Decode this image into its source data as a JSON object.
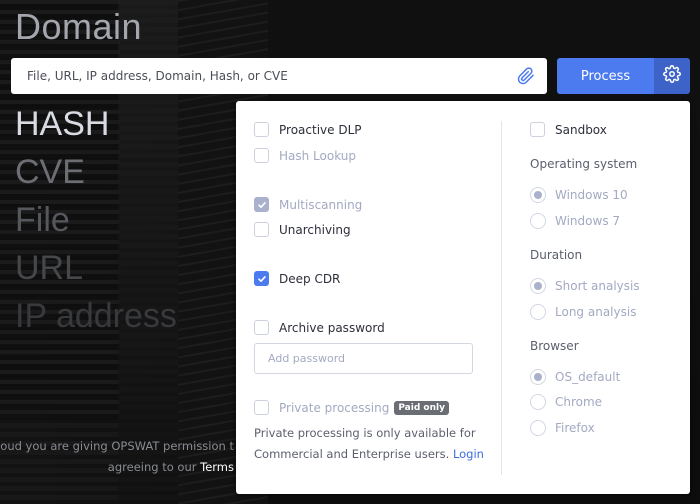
{
  "page": {
    "headline": "Domain",
    "search": {
      "placeholder": "File, URL, IP address, Domain, Hash, or CVE",
      "value": ""
    },
    "process_label": "Process",
    "icons": {
      "attach": "paperclip-icon",
      "settings": "gear-icon"
    },
    "colors": {
      "accent": "#4b7bef",
      "accent_dark": "#3d63c8",
      "link": "#3d6fe0"
    },
    "rotating_types": [
      "HASH",
      "CVE",
      "File",
      "URL",
      "IP address"
    ],
    "footer": {
      "line1": "der Cloud you are giving OPSWAT permission t",
      "line2_prefix": "agreeing to our ",
      "terms_link": "Terms"
    }
  },
  "settings_panel": {
    "left": {
      "proactive_dlp": {
        "label": "Proactive DLP",
        "checked": false,
        "disabled": false
      },
      "hash_lookup": {
        "label": "Hash Lookup",
        "checked": false,
        "disabled": true
      },
      "multiscanning": {
        "label": "Multiscanning",
        "checked": true,
        "disabled": true
      },
      "unarchiving": {
        "label": "Unarchiving",
        "checked": false,
        "disabled": false
      },
      "deep_cdr": {
        "label": "Deep CDR",
        "checked": true,
        "disabled": false
      },
      "archive_password": {
        "label": "Archive password",
        "checked": false,
        "disabled": false
      },
      "password_input": {
        "placeholder": "Add password",
        "value": ""
      },
      "private_processing": {
        "label": "Private processing",
        "checked": false,
        "disabled": true,
        "badge": "Paid only"
      },
      "private_note": "Private processing is only available for Commercial and Enterprise users.",
      "login_link": "Login"
    },
    "right": {
      "sandbox": {
        "label": "Sandbox",
        "checked": false
      },
      "os": {
        "label": "Operating system",
        "options": [
          "Windows 10",
          "Windows 7"
        ],
        "selected": "Windows 10"
      },
      "duration": {
        "label": "Duration",
        "options": [
          "Short analysis",
          "Long analysis"
        ],
        "selected": "Short analysis"
      },
      "browser": {
        "label": "Browser",
        "options": [
          "OS_default",
          "Chrome",
          "Firefox"
        ],
        "selected": "OS_default"
      }
    }
  }
}
